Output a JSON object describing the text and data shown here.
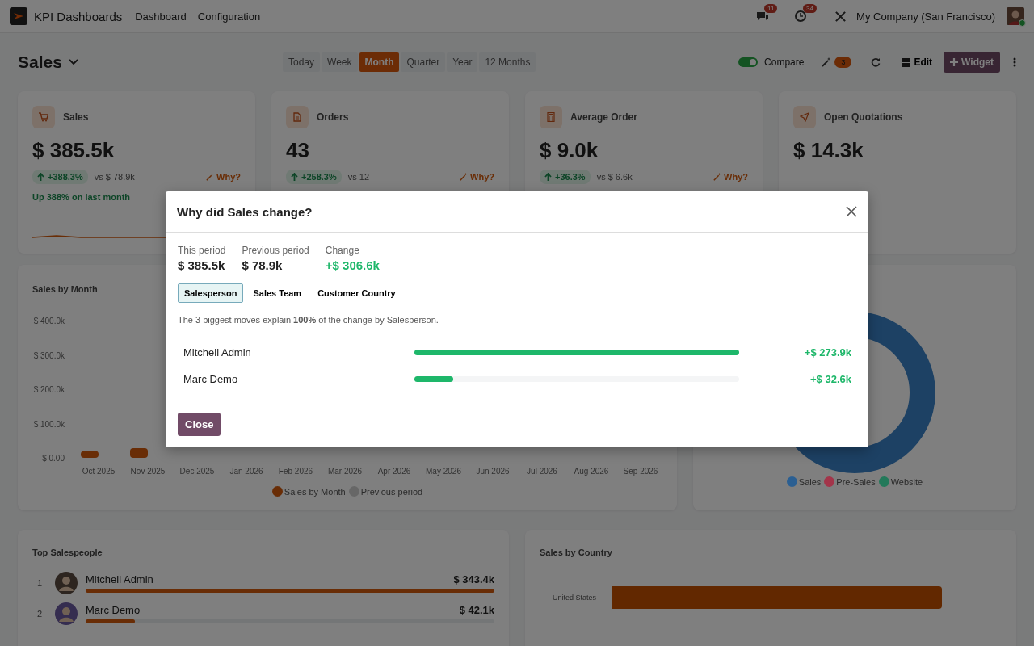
{
  "navbar": {
    "app_name": "KPI Dashboards",
    "menu": [
      "Dashboard",
      "Configuration"
    ],
    "messages_count": "11",
    "activities_count": "34",
    "company": "My Company (San Francisco)",
    "user_online": true
  },
  "header": {
    "title": "Sales",
    "periods": [
      {
        "label": "Today",
        "selected": false
      },
      {
        "label": "Week",
        "selected": false
      },
      {
        "label": "Month",
        "selected": true
      },
      {
        "label": "Quarter",
        "selected": false
      },
      {
        "label": "Year",
        "selected": false
      },
      {
        "label": "12 Months",
        "selected": false
      }
    ],
    "compare": {
      "label": "Compare",
      "on": true
    },
    "suggestions_count": "3",
    "edit_label": "Edit",
    "widget_label": "Widget"
  },
  "kpis": [
    {
      "kind": "cart",
      "title": "Sales",
      "value": "$ 385.5k",
      "delta": "+388.3%",
      "previous": "vs $ 78.9k",
      "why": "Why?",
      "note": "Up 388% on last month",
      "sparkline": true
    },
    {
      "kind": "document",
      "title": "Orders",
      "value": "43",
      "delta": "+258.3%",
      "previous": "vs 12",
      "why": "Why?"
    },
    {
      "kind": "calculator",
      "title": "Average Order",
      "value": "$ 9.0k",
      "delta": "+36.3%",
      "previous": "vs $ 6.6k",
      "why": "Why?"
    },
    {
      "kind": "send",
      "title": "Open Quotations",
      "value": "$ 14.3k"
    }
  ],
  "sales_by_month": {
    "title": "Sales by Month",
    "chart_data": {
      "type": "bar",
      "categories": [
        "Oct 2025",
        "Nov 2025",
        "Dec 2025",
        "Jan 2026",
        "Feb 2026",
        "Mar 2026",
        "Apr 2026",
        "May 2026",
        "Jun 2026",
        "Jul 2026",
        "Aug 2026",
        "Sep 2026"
      ],
      "series": [
        {
          "name": "Sales by Month",
          "color": "#d35a0c",
          "values": [
            20000,
            28000,
            null,
            null,
            null,
            null,
            null,
            null,
            null,
            null,
            null,
            null
          ]
        },
        {
          "name": "Previous period",
          "color": "#cfcfcf",
          "values": [
            null,
            null,
            null,
            null,
            null,
            null,
            null,
            null,
            null,
            null,
            null,
            null
          ]
        }
      ],
      "ylim": [
        0,
        400000
      ],
      "yticks": [
        {
          "value": 0,
          "label": "$ 0.00"
        },
        {
          "value": 100000,
          "label": "$ 100.0k"
        },
        {
          "value": 200000,
          "label": "$ 200.0k"
        },
        {
          "value": 300000,
          "label": "$ 300.0k"
        },
        {
          "value": 400000,
          "label": "$ 400.0k"
        }
      ]
    }
  },
  "sales_by_team": {
    "legend": [
      {
        "label": "Sales",
        "color": "#2b5f92"
      },
      {
        "label": "Pre-Sales",
        "color": "#a3354a"
      },
      {
        "label": "Website",
        "color": "#23795a"
      }
    ]
  },
  "top_salespeople": {
    "title": "Top Salespeople",
    "items": [
      {
        "rank": "1",
        "name": "Mitchell Admin",
        "amount": "$ 343.4k",
        "level": 1
      },
      {
        "rank": "2",
        "name": "Marc Demo",
        "amount": "$ 42.1k",
        "level": 0.12
      }
    ]
  },
  "sales_by_country": {
    "title": "Sales by Country",
    "rows": [
      {
        "label": "United States"
      }
    ]
  },
  "modal": {
    "title": "Why did Sales change?",
    "stats": [
      {
        "label": "This period",
        "value": "$ 385.5k",
        "kind": "plain"
      },
      {
        "label": "Previous period",
        "value": "$ 78.9k",
        "kind": "plain"
      },
      {
        "label": "Change",
        "value": "+$ 306.6k",
        "kind": "positive"
      }
    ],
    "tabs": [
      {
        "label": "Salesperson",
        "selected": true
      },
      {
        "label": "Sales Team",
        "selected": false
      },
      {
        "label": "Customer Country",
        "selected": false
      }
    ],
    "summary": "The 3 biggest moves explain **100%** of the change by Salesperson.",
    "moves": [
      {
        "name": "Mitchell Admin",
        "level": 1,
        "amount": "+$ 273.9k"
      },
      {
        "name": "Marc Demo",
        "level": 0.12,
        "amount": "+$ 32.6k"
      }
    ],
    "close_label": "Close"
  }
}
